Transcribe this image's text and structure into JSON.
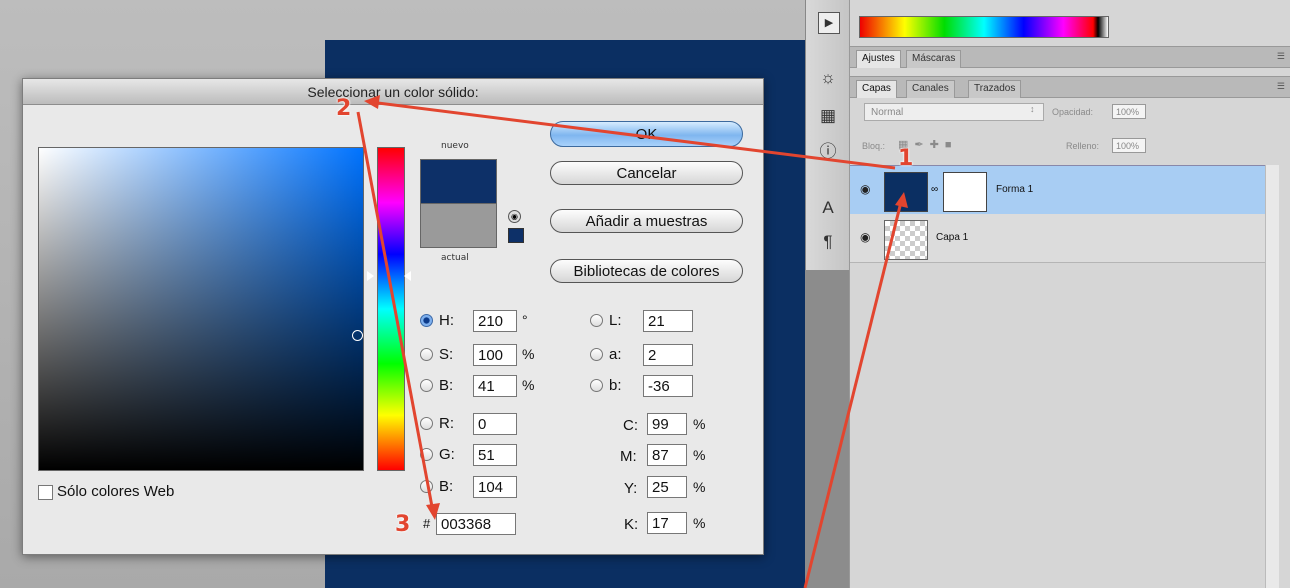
{
  "dialog": {
    "title": "Seleccionar un color sólido:",
    "new_label": "nuevo",
    "current_label": "actual",
    "buttons": {
      "ok": "OK",
      "cancel": "Cancelar",
      "add_swatch": "Añadir a muestras",
      "libraries": "Bibliotecas de colores"
    },
    "hsb": [
      {
        "label": "H:",
        "value": "210",
        "unit": "°",
        "selected": true
      },
      {
        "label": "S:",
        "value": "100",
        "unit": "%"
      },
      {
        "label": "B:",
        "value": "41",
        "unit": "%"
      }
    ],
    "rgb": [
      {
        "label": "R:",
        "value": "0"
      },
      {
        "label": "G:",
        "value": "51"
      },
      {
        "label": "B:",
        "value": "104"
      }
    ],
    "lab": [
      {
        "label": "L:",
        "value": "21"
      },
      {
        "label": "a:",
        "value": "2"
      },
      {
        "label": "b:",
        "value": "-36"
      }
    ],
    "cmyk": [
      {
        "label": "C:",
        "value": "99",
        "unit": "%"
      },
      {
        "label": "M:",
        "value": "87",
        "unit": "%"
      },
      {
        "label": "Y:",
        "value": "25",
        "unit": "%"
      },
      {
        "label": "K:",
        "value": "17",
        "unit": "%"
      }
    ],
    "hex_symbol": "#",
    "hex": "003368",
    "web_only_label": "Sólo colores Web",
    "new_color": "#003368"
  },
  "panels": {
    "tabs_top": [
      "Ajustes",
      "Máscaras"
    ],
    "tabs_layers": [
      "Capas",
      "Canales",
      "Trazados"
    ],
    "blend_mode": "Normal",
    "opacity_label": "Opacidad:",
    "opacity_value": "100%",
    "lock_label": "Bloq.:",
    "fill_label": "Relleno:",
    "fill_value": "100%",
    "layers": [
      {
        "name": "Forma 1",
        "selected": true
      },
      {
        "name": "Capa 1"
      }
    ]
  },
  "callouts": [
    "1",
    "2",
    "3"
  ],
  "colors": {
    "accent": "#e2452f",
    "document": "#0b2f62",
    "selection": "#a8cdf3"
  }
}
